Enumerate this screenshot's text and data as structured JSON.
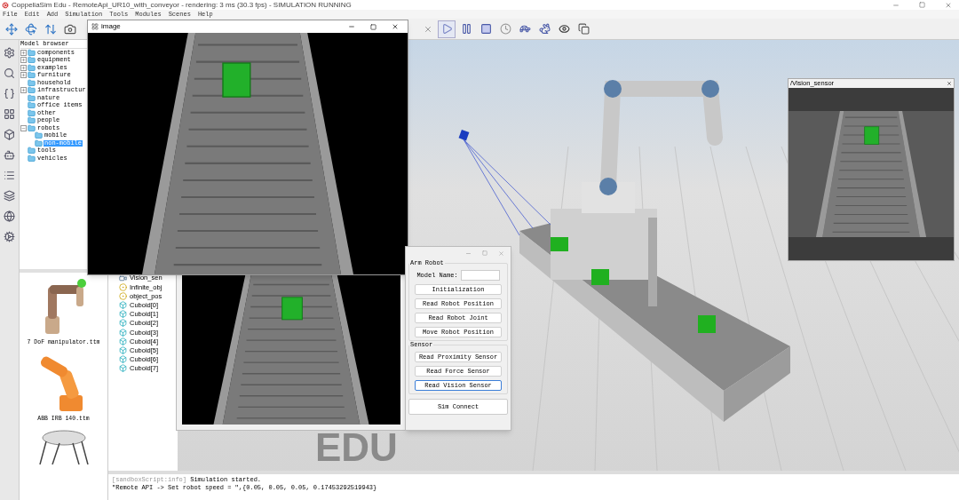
{
  "window": {
    "title": "CoppeliaSim Edu - RemoteApi_UR10_with_conveyor - rendering: 3 ms (30.3 fps) - SIMULATION RUNNING"
  },
  "menu": [
    "File",
    "Edit",
    "Add",
    "Simulation",
    "Tools",
    "Modules",
    "Scenes",
    "Help"
  ],
  "model_browser": {
    "title": "Model browser",
    "tree": [
      {
        "label": "components",
        "expanded": false,
        "selected": false
      },
      {
        "label": "equipment",
        "expanded": false,
        "selected": false
      },
      {
        "label": "examples",
        "expanded": false,
        "selected": false
      },
      {
        "label": "furniture",
        "expanded": false,
        "selected": false
      },
      {
        "label": "household",
        "selected": false
      },
      {
        "label": "infrastructur",
        "expanded": false,
        "selected": false
      },
      {
        "label": "nature",
        "selected": false
      },
      {
        "label": "office items",
        "selected": false
      },
      {
        "label": "other",
        "selected": false
      },
      {
        "label": "people",
        "selected": false
      },
      {
        "label": "robots",
        "expanded": true,
        "selected": false,
        "children": [
          {
            "label": "mobile",
            "selected": false
          },
          {
            "label": "non-mobile",
            "selected": true
          }
        ]
      },
      {
        "label": "tools",
        "selected": false
      },
      {
        "label": "vehicles",
        "selected": false
      }
    ]
  },
  "model_thumbnails": [
    {
      "kind": "arm",
      "label": "7 DoF manipulator.ttm"
    },
    {
      "kind": "industrial",
      "label": "ABB IRB 140.ttm"
    },
    {
      "kind": "delta"
    }
  ],
  "scene_hierarchy": [
    {
      "kind": "camera",
      "label": "Vision_sen"
    },
    {
      "kind": "dummy",
      "label": "Infinite_obj"
    },
    {
      "kind": "dummy",
      "label": "object_pos"
    },
    {
      "kind": "shape",
      "label": "Cuboid[0]"
    },
    {
      "kind": "shape",
      "label": "Cuboid[1]"
    },
    {
      "kind": "shape",
      "label": "Cuboid[2]"
    },
    {
      "kind": "shape",
      "label": "Cuboid[3]"
    },
    {
      "kind": "shape",
      "label": "Cuboid[4]"
    },
    {
      "kind": "shape",
      "label": "Cuboid[5]"
    },
    {
      "kind": "shape",
      "label": "Cuboid[6]"
    },
    {
      "kind": "shape",
      "label": "Cuboid[7]"
    }
  ],
  "image_window": {
    "title": "image"
  },
  "dialog": {
    "sections": [
      {
        "title": "Arm Robot",
        "field": {
          "label": "Model Name:"
        },
        "buttons": [
          {
            "label": "Initialization",
            "focused": false
          },
          {
            "label": "Read Robot Position",
            "focused": false
          },
          {
            "label": "Read Robot Joint",
            "focused": false
          },
          {
            "label": "Move Robot Position",
            "focused": false
          }
        ]
      },
      {
        "title": "Sensor",
        "buttons": [
          {
            "label": "Read Proximity Sensor",
            "focused": false
          },
          {
            "label": "Read Force Sensor",
            "focused": false
          },
          {
            "label": "Read Vision Sensor",
            "focused": true
          }
        ]
      }
    ],
    "footer_button": "Sim Connect"
  },
  "vision_sensor": {
    "title": "/Vision_sensor"
  },
  "viewport": {
    "logo_text": "EDU"
  },
  "console": [
    {
      "source": "[sandboxScript:info]",
      "text": "Simulation started."
    },
    {
      "text": "\"Remote API -> Set robot speed = \",{0.05, 0.05, 0.05, 0.17453292519943}"
    }
  ]
}
